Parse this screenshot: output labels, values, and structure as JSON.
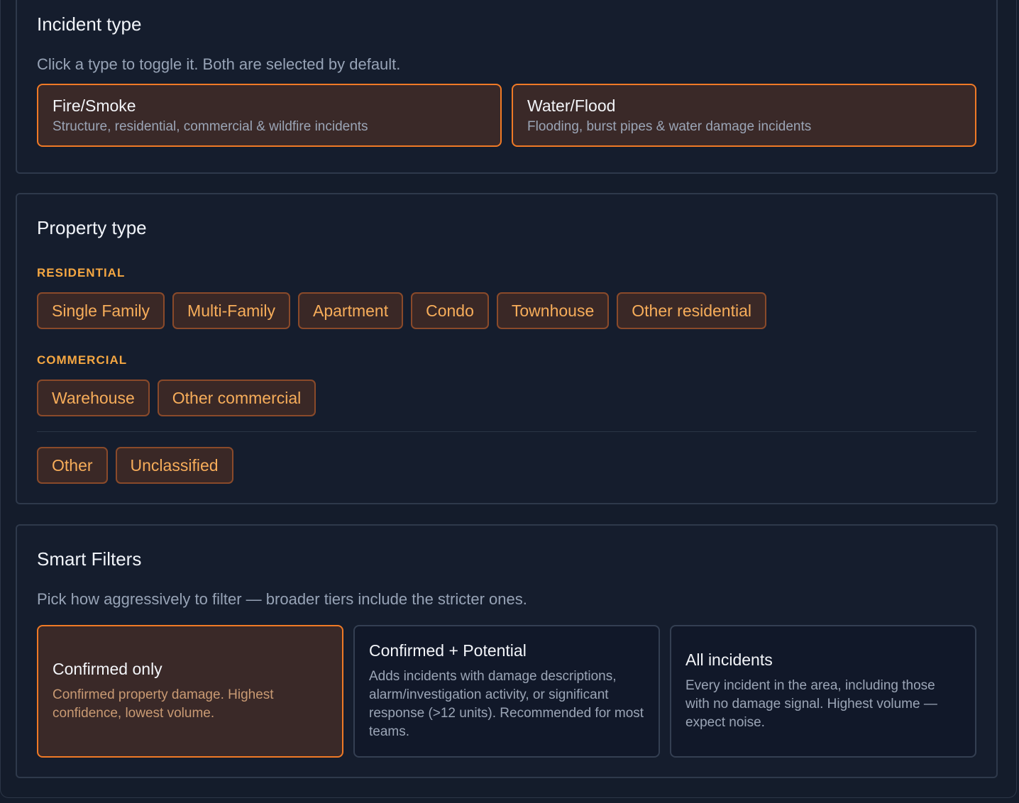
{
  "incident_type": {
    "title": "Incident type",
    "hint": "Click a type to toggle it. Both are selected by default.",
    "options": [
      {
        "label": "Fire/Smoke",
        "description": "Structure, residential, commercial & wildfire incidents",
        "selected": true
      },
      {
        "label": "Water/Flood",
        "description": "Flooding, burst pipes & water damage incidents",
        "selected": true
      }
    ]
  },
  "property_type": {
    "title": "Property type",
    "residential": {
      "label": "RESIDENTIAL",
      "items": [
        "Single Family",
        "Multi-Family",
        "Apartment",
        "Condo",
        "Townhouse",
        "Other residential"
      ]
    },
    "commercial": {
      "label": "COMMERCIAL",
      "items": [
        "Warehouse",
        "Other commercial"
      ]
    },
    "other": {
      "items": [
        "Other",
        "Unclassified"
      ]
    }
  },
  "smart_filters": {
    "title": "Smart Filters",
    "hint": "Pick how aggressively to filter — broader tiers include the stricter ones.",
    "tiers": [
      {
        "label": "Confirmed only",
        "description": "Confirmed property damage. Highest confidence, lowest volume.",
        "selected": true
      },
      {
        "label": "Confirmed + Potential",
        "description": "Adds incidents with damage descriptions, alarm/investigation activity, or significant response (>12 units). Recommended for most teams.",
        "selected": false
      },
      {
        "label": "All incidents",
        "description": "Every incident in the area, including those with no damage signal. Highest volume — expect noise.",
        "selected": false
      }
    ]
  },
  "colors": {
    "accent": "#f07a26",
    "chip_text": "#f7ad5a",
    "background": "#141c2b"
  }
}
